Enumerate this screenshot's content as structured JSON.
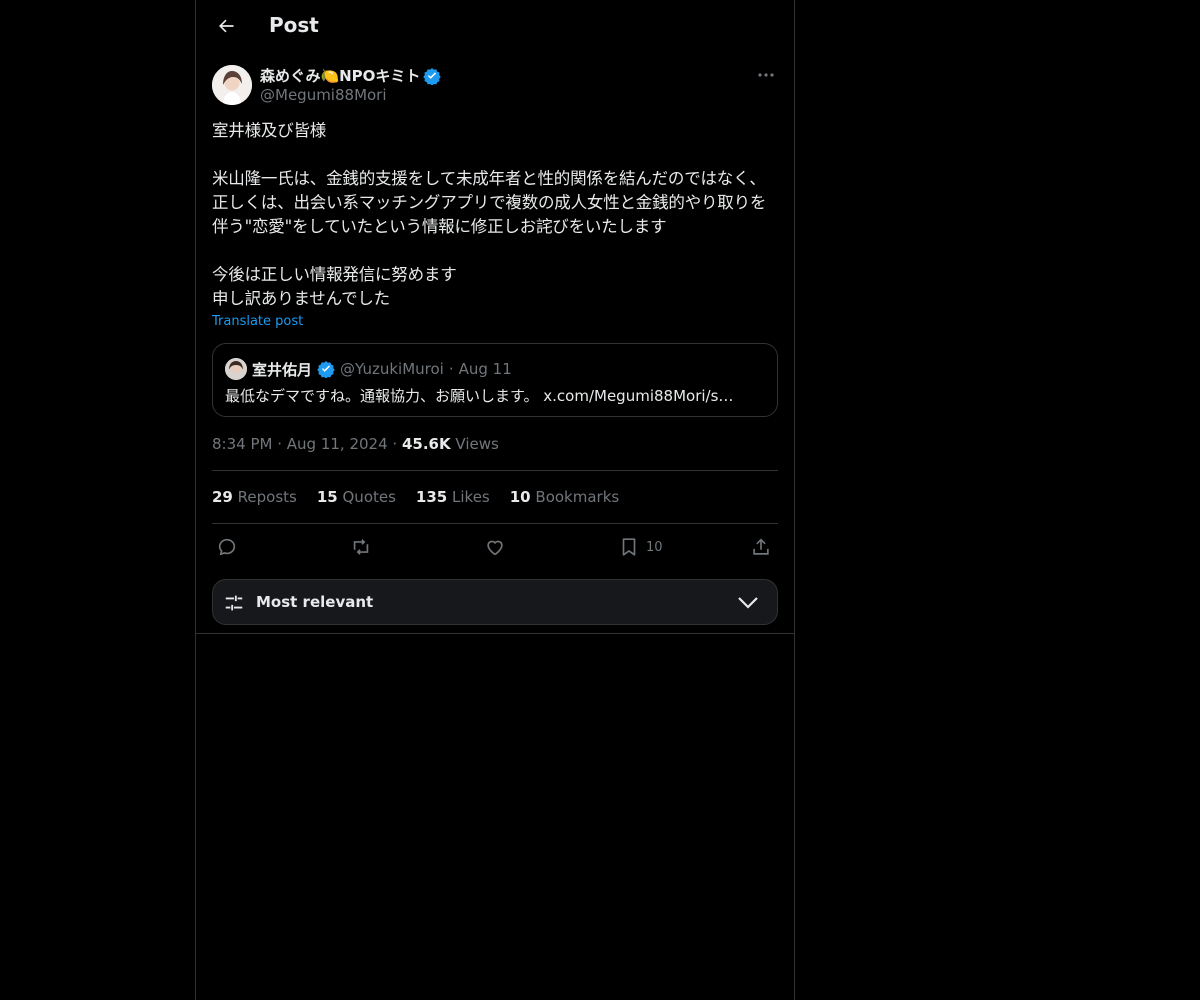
{
  "header": {
    "title": "Post"
  },
  "post": {
    "display_name": "森めぐみ🍋NPOキミト",
    "handle": "@Megumi88Mori",
    "text": "室井様及び皆様\n\n米山隆一氏は、金銭的支援をして未成年者と性的関係を結んだのではなく、正しくは、出会い系マッチングアプリで複数の成人女性と金銭的やり取りを伴う\"恋愛\"をしていたという情報に修正しお詫びをいたします\n\n今後は正しい情報発信に努めます\n申し訳ありませんでした",
    "translate_label": "Translate post",
    "time": "8:34 PM",
    "date": "Aug 11, 2024",
    "views_count": "45.6K",
    "views_label": "Views"
  },
  "quote": {
    "display_name": "室井佑月",
    "handle": "@YuzukiMuroi",
    "date": "Aug 11",
    "text": "最低なデマですね。通報協力、お願いします。 x.com/Megumi88Mori/s…"
  },
  "stats": [
    {
      "count": "29",
      "label": "Reposts"
    },
    {
      "count": "15",
      "label": "Quotes"
    },
    {
      "count": "135",
      "label": "Likes"
    },
    {
      "count": "10",
      "label": "Bookmarks"
    }
  ],
  "actions": {
    "bookmark_count": "10"
  },
  "sort": {
    "label": "Most relevant"
  },
  "colors": {
    "accent": "#1d9bf0",
    "muted": "#71767b",
    "text": "#e7e9ea",
    "border": "#2f3336",
    "background": "#000000"
  }
}
